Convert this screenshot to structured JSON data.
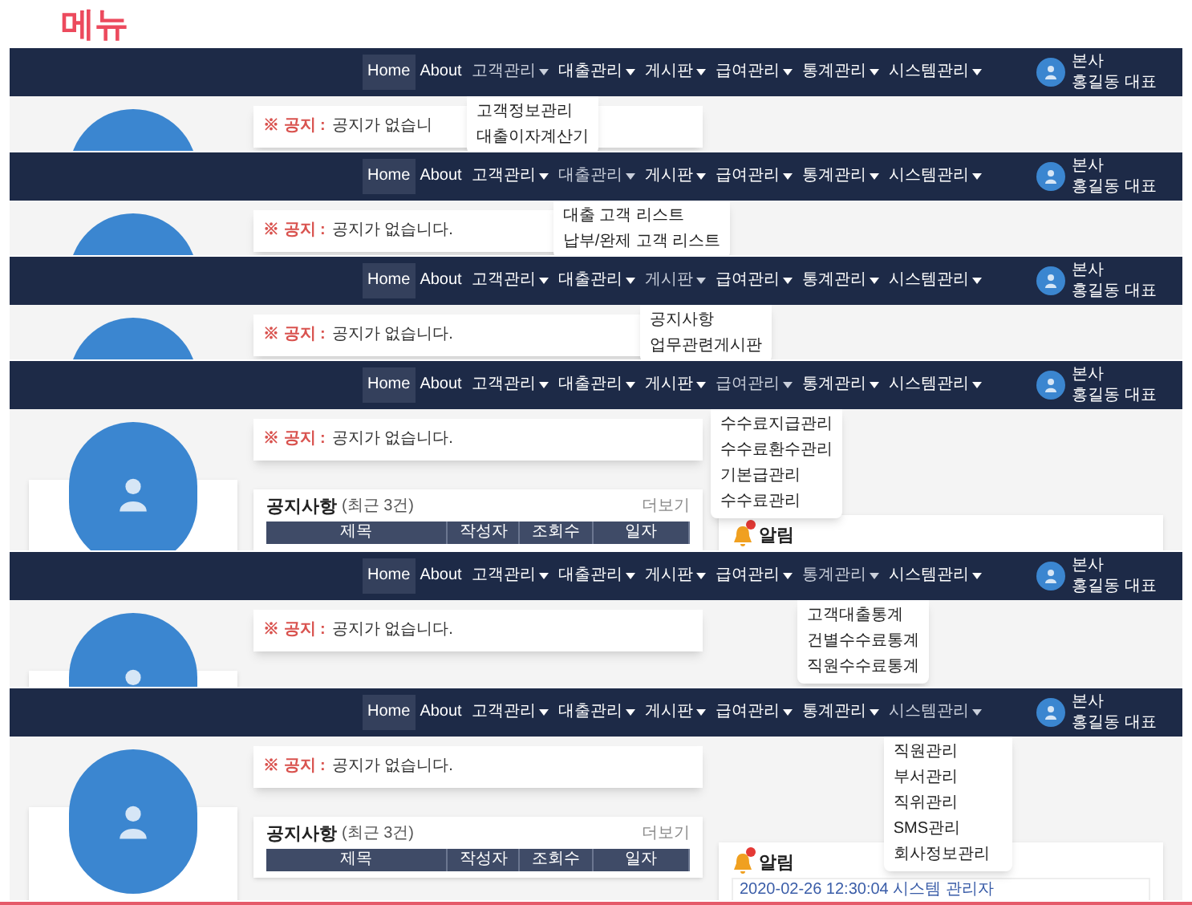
{
  "title": "메뉴",
  "screens": [
    {
      "nav": [
        {
          "label": "Home",
          "selected": true,
          "dropdown": false,
          "expanded": false
        },
        {
          "label": "About",
          "selected": false,
          "dropdown": false,
          "expanded": false
        },
        {
          "label": "고객관리",
          "selected": false,
          "dropdown": true,
          "expanded": true
        },
        {
          "label": "대출관리",
          "selected": false,
          "dropdown": true,
          "expanded": false
        },
        {
          "label": "게시판",
          "selected": false,
          "dropdown": true,
          "expanded": false
        },
        {
          "label": "급여관리",
          "selected": false,
          "dropdown": true,
          "expanded": false
        },
        {
          "label": "통계관리",
          "selected": false,
          "dropdown": true,
          "expanded": false
        },
        {
          "label": "시스템관리",
          "selected": false,
          "dropdown": true,
          "expanded": false
        }
      ],
      "menu_items": [
        "고객정보관리",
        "대출이자계산기"
      ],
      "user": {
        "branch": "본사",
        "name": "홍길동 대표"
      },
      "notice": {
        "label": "※ 공지 :",
        "text": "공지가 없습니"
      }
    },
    {
      "nav": [
        {
          "label": "Home",
          "selected": true,
          "dropdown": false,
          "expanded": false
        },
        {
          "label": "About",
          "selected": false,
          "dropdown": false,
          "expanded": false
        },
        {
          "label": "고객관리",
          "selected": false,
          "dropdown": true,
          "expanded": false
        },
        {
          "label": "대출관리",
          "selected": false,
          "dropdown": true,
          "expanded": true
        },
        {
          "label": "게시판",
          "selected": false,
          "dropdown": true,
          "expanded": false
        },
        {
          "label": "급여관리",
          "selected": false,
          "dropdown": true,
          "expanded": false
        },
        {
          "label": "통계관리",
          "selected": false,
          "dropdown": true,
          "expanded": false
        },
        {
          "label": "시스템관리",
          "selected": false,
          "dropdown": true,
          "expanded": false
        }
      ],
      "menu_items": [
        "대출 고객 리스트",
        "납부/완제 고객 리스트"
      ],
      "user": {
        "branch": "본사",
        "name": "홍길동 대표"
      },
      "notice": {
        "label": "※ 공지 :",
        "text": "공지가 없습니다."
      }
    },
    {
      "nav": [
        {
          "label": "Home",
          "selected": true,
          "dropdown": false,
          "expanded": false
        },
        {
          "label": "About",
          "selected": false,
          "dropdown": false,
          "expanded": false
        },
        {
          "label": "고객관리",
          "selected": false,
          "dropdown": true,
          "expanded": false
        },
        {
          "label": "대출관리",
          "selected": false,
          "dropdown": true,
          "expanded": false
        },
        {
          "label": "게시판",
          "selected": false,
          "dropdown": true,
          "expanded": true
        },
        {
          "label": "급여관리",
          "selected": false,
          "dropdown": true,
          "expanded": false
        },
        {
          "label": "통계관리",
          "selected": false,
          "dropdown": true,
          "expanded": false
        },
        {
          "label": "시스템관리",
          "selected": false,
          "dropdown": true,
          "expanded": false
        }
      ],
      "menu_items": [
        "공지사항",
        "업무관련게시판"
      ],
      "user": {
        "branch": "본사",
        "name": "홍길동 대표"
      },
      "notice": {
        "label": "※ 공지 :",
        "text": "공지가 없습니다."
      }
    },
    {
      "nav": [
        {
          "label": "Home",
          "selected": true,
          "dropdown": false,
          "expanded": false
        },
        {
          "label": "About",
          "selected": false,
          "dropdown": false,
          "expanded": false
        },
        {
          "label": "고객관리",
          "selected": false,
          "dropdown": true,
          "expanded": false
        },
        {
          "label": "대출관리",
          "selected": false,
          "dropdown": true,
          "expanded": false
        },
        {
          "label": "게시판",
          "selected": false,
          "dropdown": true,
          "expanded": false
        },
        {
          "label": "급여관리",
          "selected": false,
          "dropdown": true,
          "expanded": true
        },
        {
          "label": "통계관리",
          "selected": false,
          "dropdown": true,
          "expanded": false
        },
        {
          "label": "시스템관리",
          "selected": false,
          "dropdown": true,
          "expanded": false
        }
      ],
      "menu_items": [
        "수수료지급관리",
        "수수료환수관리",
        "기본급관리",
        "수수료관리"
      ],
      "user": {
        "branch": "본사",
        "name": "홍길동 대표"
      },
      "notice": {
        "label": "※ 공지 :",
        "text": "공지가 없습니다."
      },
      "board": {
        "title": "공지사항",
        "subtitle": "(최근 3건)",
        "more": "더보기",
        "columns": [
          "제목",
          "작성자",
          "조회수",
          "일자"
        ]
      },
      "alerts": {
        "title": "알림"
      }
    },
    {
      "nav": [
        {
          "label": "Home",
          "selected": true,
          "dropdown": false,
          "expanded": false
        },
        {
          "label": "About",
          "selected": false,
          "dropdown": false,
          "expanded": false
        },
        {
          "label": "고객관리",
          "selected": false,
          "dropdown": true,
          "expanded": false
        },
        {
          "label": "대출관리",
          "selected": false,
          "dropdown": true,
          "expanded": false
        },
        {
          "label": "게시판",
          "selected": false,
          "dropdown": true,
          "expanded": false
        },
        {
          "label": "급여관리",
          "selected": false,
          "dropdown": true,
          "expanded": false
        },
        {
          "label": "통계관리",
          "selected": false,
          "dropdown": true,
          "expanded": true
        },
        {
          "label": "시스템관리",
          "selected": false,
          "dropdown": true,
          "expanded": false
        }
      ],
      "menu_items": [
        "고객대출통계",
        "건별수수료통계",
        "직원수수료통계"
      ],
      "user": {
        "branch": "본사",
        "name": "홍길동 대표"
      },
      "notice": {
        "label": "※ 공지 :",
        "text": "공지가 없습니다."
      }
    },
    {
      "nav": [
        {
          "label": "Home",
          "selected": true,
          "dropdown": false,
          "expanded": false
        },
        {
          "label": "About",
          "selected": false,
          "dropdown": false,
          "expanded": false
        },
        {
          "label": "고객관리",
          "selected": false,
          "dropdown": true,
          "expanded": false
        },
        {
          "label": "대출관리",
          "selected": false,
          "dropdown": true,
          "expanded": false
        },
        {
          "label": "게시판",
          "selected": false,
          "dropdown": true,
          "expanded": false
        },
        {
          "label": "급여관리",
          "selected": false,
          "dropdown": true,
          "expanded": false
        },
        {
          "label": "통계관리",
          "selected": false,
          "dropdown": true,
          "expanded": false
        },
        {
          "label": "시스템관리",
          "selected": false,
          "dropdown": true,
          "expanded": true
        }
      ],
      "menu_items": [
        "직원관리",
        "부서관리",
        "직위관리",
        "SMS관리",
        "회사정보관리"
      ],
      "user": {
        "branch": "본사",
        "name": "홍길동 대표"
      },
      "notice": {
        "label": "※ 공지 :",
        "text": "공지가 없습니다."
      },
      "board": {
        "title": "공지사항",
        "subtitle": "(최근 3건)",
        "more": "더보기",
        "columns": [
          "제목",
          "작성자",
          "조회수",
          "일자"
        ]
      },
      "alerts": {
        "title": "알림",
        "entries": [
          "2020-02-26 12:30:04 시스템 관리자"
        ]
      }
    }
  ]
}
